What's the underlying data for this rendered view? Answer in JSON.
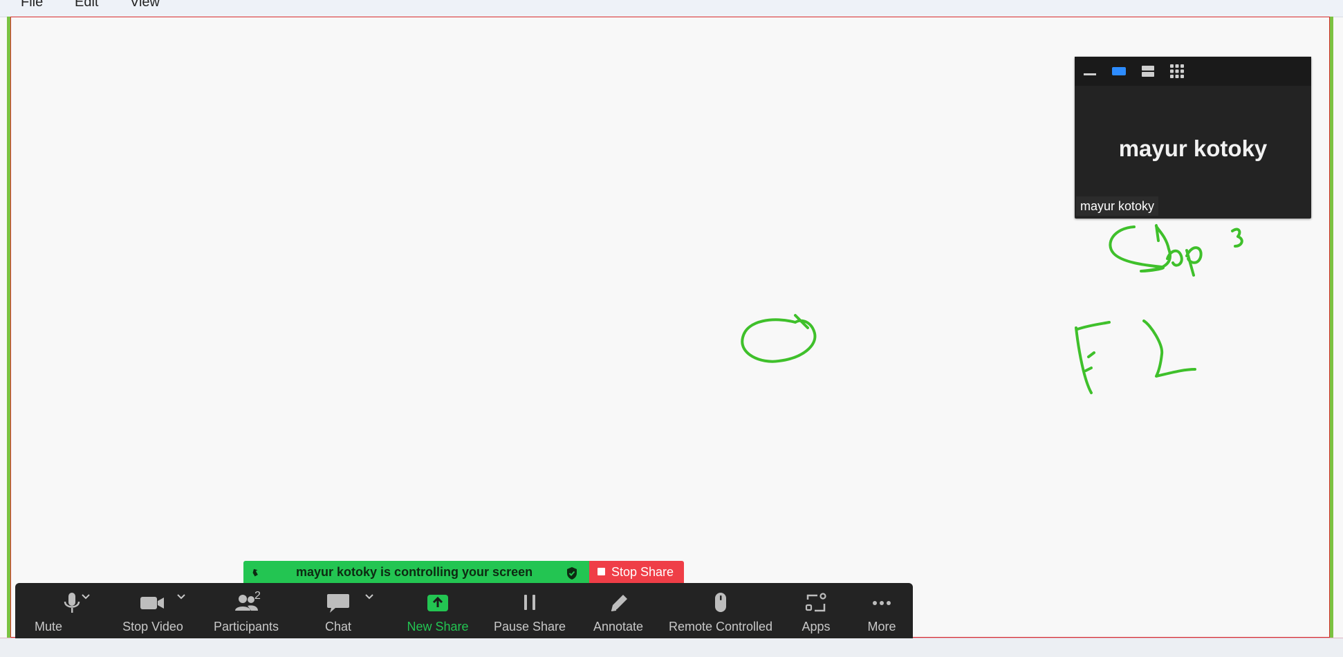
{
  "menubar": {
    "items": [
      "File",
      "Edit",
      "View"
    ]
  },
  "video_panel": {
    "display_name": "mayur kotoky",
    "name_tag": "mayur kotoky",
    "view_buttons": [
      "minimize-icon",
      "single-view-icon",
      "side-by-side-icon",
      "gallery-grid-icon"
    ],
    "active_view": "single-view-icon"
  },
  "control_banner": {
    "message": "mayur kotoky is controlling your screen",
    "stop_share_label": "Stop Share"
  },
  "toolbar": {
    "mute": "Mute",
    "stop_video": "Stop Video",
    "participants": "Participants",
    "participant_count": "2",
    "chat": "Chat",
    "new_share": "New Share",
    "pause_share": "Pause Share",
    "annotate": "Annotate",
    "remote_controlled": "Remote Controlled",
    "apps": "Apps",
    "more": "More"
  },
  "colors": {
    "annotation": "#3fc02b",
    "accent_green": "#23c552",
    "stop_red": "#ef3e47",
    "frame_green": "#7cc242",
    "toolbar_bg": "#232323"
  }
}
